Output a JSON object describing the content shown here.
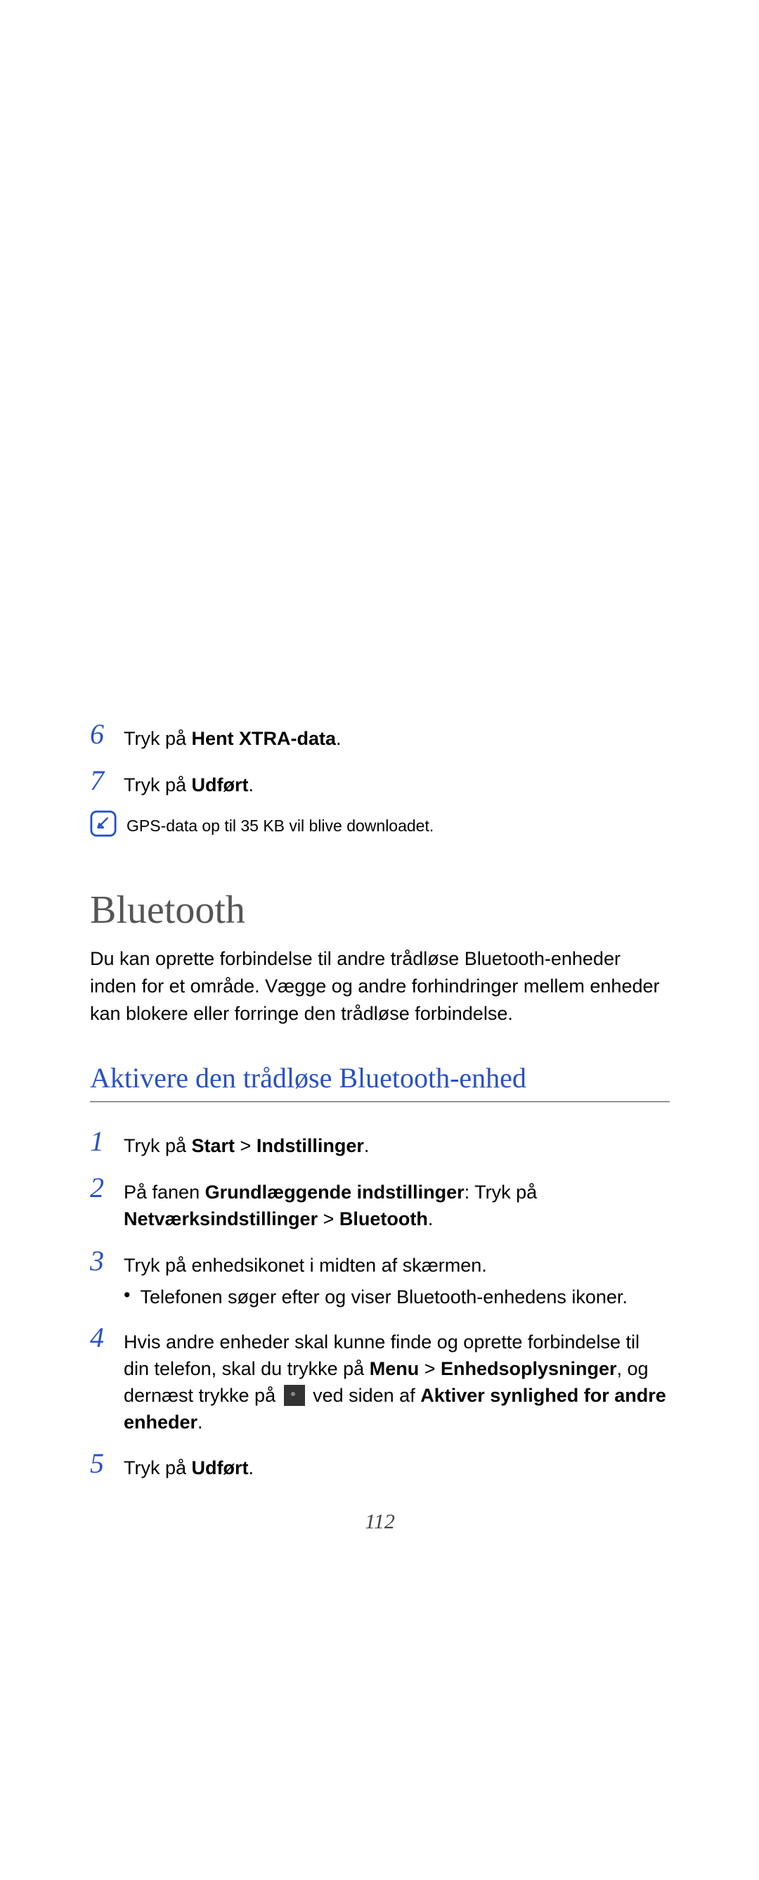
{
  "steps_gps": [
    {
      "num": "6",
      "parts": [
        {
          "text": "Tryk på ",
          "bold": false
        },
        {
          "text": "Hent XTRA-data",
          "bold": true
        },
        {
          "text": ".",
          "bold": false
        }
      ]
    },
    {
      "num": "7",
      "parts": [
        {
          "text": "Tryk på ",
          "bold": false
        },
        {
          "text": "Udført",
          "bold": true
        },
        {
          "text": ".",
          "bold": false
        }
      ]
    }
  ],
  "note_text": "GPS-data op til 35 KB vil blive downloadet.",
  "heading_bluetooth": "Bluetooth",
  "bluetooth_intro": "Du kan oprette forbindelse til andre trådløse Bluetooth-enheder inden for et område. Vægge og andre forhindringer mellem enheder kan blokere eller forringe den trådløse forbindelse.",
  "heading_activate": "Aktivere den trådløse Bluetooth-enhed",
  "steps_bt": {
    "step1": {
      "num": "1",
      "parts": [
        {
          "text": "Tryk på ",
          "bold": false
        },
        {
          "text": "Start",
          "bold": true
        },
        {
          "text": " > ",
          "bold": false
        },
        {
          "text": "Indstillinger",
          "bold": true
        },
        {
          "text": ".",
          "bold": false
        }
      ]
    },
    "step2": {
      "num": "2",
      "parts": [
        {
          "text": "På fanen ",
          "bold": false
        },
        {
          "text": "Grundlæggende indstillinger",
          "bold": true
        },
        {
          "text": ": Tryk på ",
          "bold": false
        },
        {
          "text": "Netværksindstillinger",
          "bold": true
        },
        {
          "text": " > ",
          "bold": false
        },
        {
          "text": "Bluetooth",
          "bold": true
        },
        {
          "text": ".",
          "bold": false
        }
      ]
    },
    "step3": {
      "num": "3",
      "text": "Tryk på enhedsikonet i midten af skærmen.",
      "bullet": "Telefonen søger efter og viser Bluetooth-enhedens ikoner."
    },
    "step4": {
      "num": "4",
      "line1_parts": [
        {
          "text": "Hvis andre enheder skal kunne finde og oprette forbindelse til din telefon, skal du trykke på ",
          "bold": false
        },
        {
          "text": "Menu",
          "bold": true
        },
        {
          "text": " > ",
          "bold": false
        },
        {
          "text": "Enhedsoplysninger",
          "bold": true
        },
        {
          "text": ", og dernæst trykke på ",
          "bold": false
        }
      ],
      "line1_after_icon_parts": [
        {
          "text": " ved siden af ",
          "bold": false
        },
        {
          "text": "Aktiver synlighed for andre enheder",
          "bold": true
        },
        {
          "text": ".",
          "bold": false
        }
      ]
    },
    "step5": {
      "num": "5",
      "parts": [
        {
          "text": "Tryk på ",
          "bold": false
        },
        {
          "text": "Udført",
          "bold": true
        },
        {
          "text": ".",
          "bold": false
        }
      ]
    }
  },
  "page_number": "112",
  "icons": {
    "note_icon_name": "note-pencil-icon",
    "checkbox_icon_name": "checkbox-icon"
  }
}
